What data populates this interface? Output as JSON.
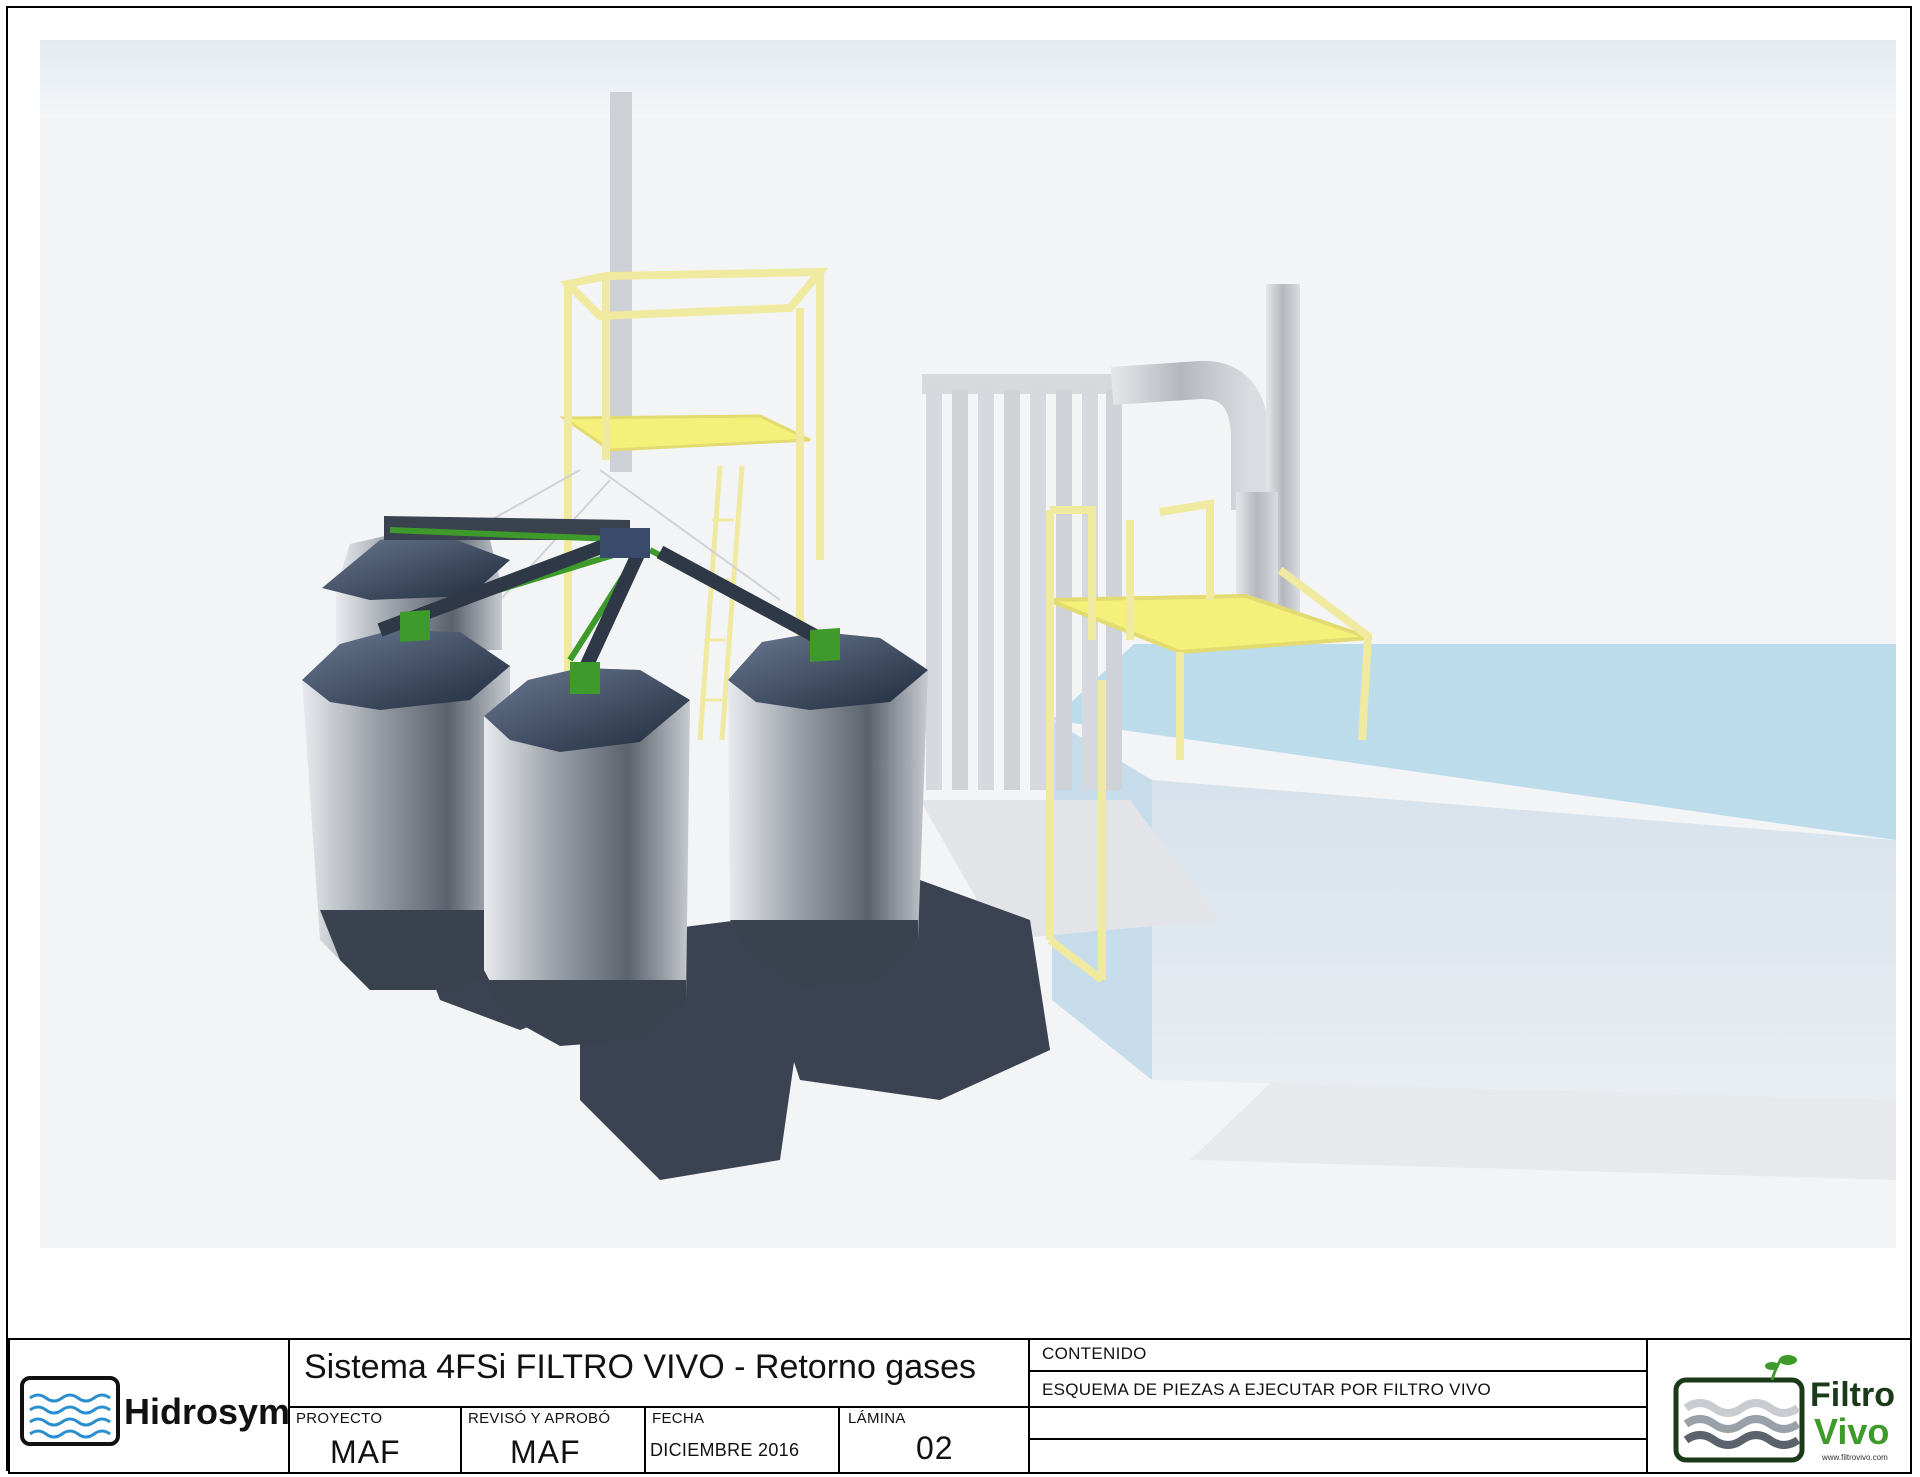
{
  "project": {
    "title": "Sistema 4FSi FILTRO VIVO - Retorno gases"
  },
  "fields": {
    "proyecto_label": "PROYECTO",
    "proyecto_value": "MAF",
    "reviso_label": "REVISÓ Y APROBÓ",
    "reviso_value": "MAF",
    "fecha_label": "FECHA",
    "fecha_value": "DICIEMBRE 2016",
    "lamina_label": "LÁMINA",
    "lamina_value": "02",
    "contenido_label": "CONTENIDO",
    "contenido_value": "ESQUEMA DE PIEZAS A EJECUTAR POR FILTRO VIVO"
  },
  "logos": {
    "left_brand": "Hidrosym",
    "right_brand_line1": "Filtro",
    "right_brand_line2": "Vivo",
    "right_url": "www.filtrovivo.com"
  },
  "colors": {
    "railing_yellow": "#f0e9a0",
    "platform_yellow": "#f5f07a",
    "water_blue": "#bcdcec",
    "silo_dark": "#3a4250",
    "frame_green": "#3e9a2a",
    "pipe_grey": "#c9ccd0",
    "shadow": "#3b4352"
  }
}
